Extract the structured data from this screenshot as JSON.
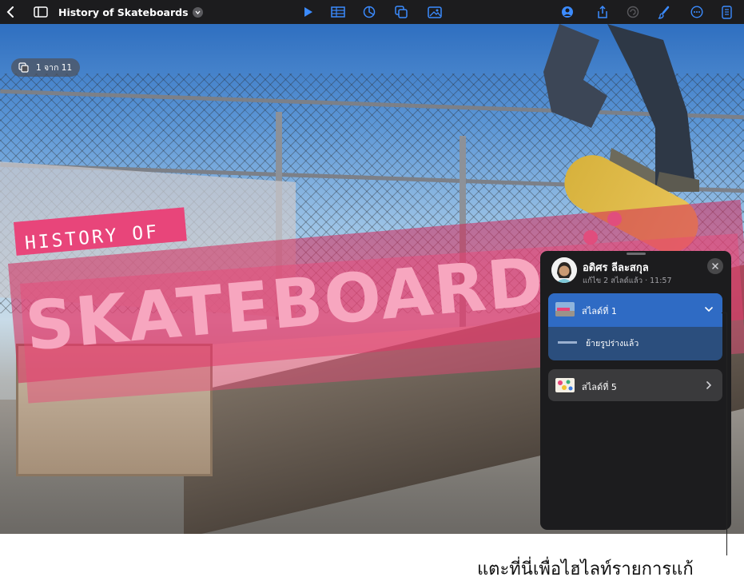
{
  "toolbar": {
    "document_title": "History of Skateboards",
    "icons": [
      "back-chevron-icon",
      "sidebar-icon",
      "title-chevron-icon",
      "play-icon",
      "table-icon",
      "chart-icon",
      "shape-icon",
      "media-icon",
      "collaborate-icon",
      "share-icon",
      "undo-icon",
      "format-brush-icon",
      "more-icon",
      "document-icon"
    ]
  },
  "slide": {
    "counter_text": "1 จาก 11",
    "title_line1": "HISTORY OF",
    "title_line2": "SKATEBOARDS"
  },
  "edits_panel": {
    "user_name": "อดิศร ลีละสกุล",
    "edit_summary": "แก้ไข 2 สไลด์แล้ว · 11:57",
    "items": [
      {
        "label": "สไลด์ที่ 1",
        "expanded": true,
        "change": "ย้ายรูปร่างแล้ว"
      },
      {
        "label": "สไลด์ที่ 5",
        "expanded": false
      }
    ]
  },
  "callout": {
    "text": "แตะที่นี่เพื่อไฮไลท์รายการแก้"
  },
  "colors": {
    "accent_blue": "#2f6bc4",
    "toolbar_bg": "#1c1c1e",
    "title_pink": "#e8457a"
  }
}
